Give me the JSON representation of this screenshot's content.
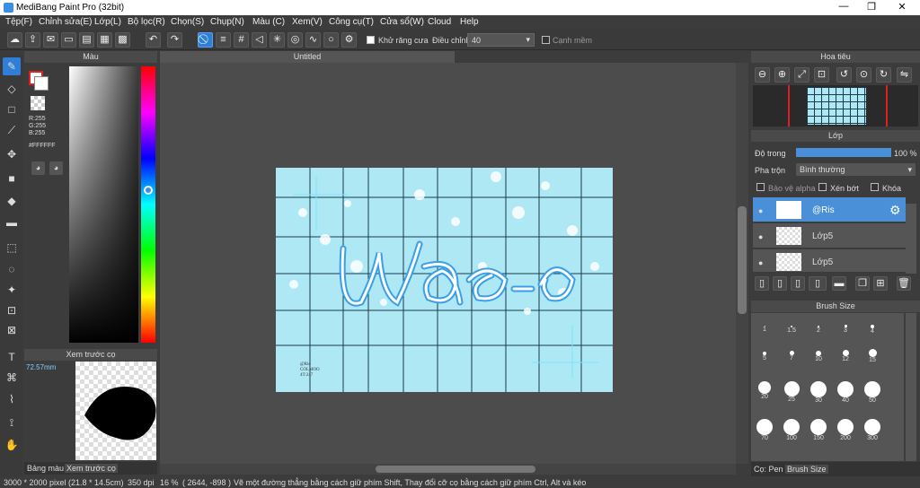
{
  "window": {
    "title": "MediBang Paint Pro (32bit)",
    "min": "—",
    "max": "❐",
    "close": "✕"
  },
  "menu": [
    "Tệp(F)",
    "Chỉnh sửa(E)",
    "Lớp(L)",
    "Bộ lọc(R)",
    "Chọn(S)",
    "Chụp(N)",
    "Màu (C)",
    "Xem(V)",
    "Công cụ(T)",
    "Cửa sổ(W)",
    "Cloud",
    "Help"
  ],
  "toolbar": {
    "antialias_label": "Khử răng cưa",
    "adjust_label": "Điều chỉnh",
    "adjust_value": "40",
    "edge_label": "Cạnh mềm"
  },
  "color_panel": {
    "title": "Màu",
    "r": "R:255",
    "g": "G:255",
    "b": "B:255",
    "hex": "#FFFFFF"
  },
  "preview_panel": {
    "title": "Xem trước cọ",
    "size": "72.57mm"
  },
  "left_tabs": {
    "palette": "Bảng màu",
    "preview": "Xem trước cọ"
  },
  "canvas": {
    "tab": "Untitled",
    "text": "Wao-o",
    "watermark": "@Ris\nCOLMOO\n4T:247"
  },
  "navigator": {
    "title": "Hoa tiêu"
  },
  "layers": {
    "title": "Lớp",
    "opacity_label": "Độ trong",
    "opacity_value": "100 %",
    "blend_label": "Pha trộn",
    "blend_value": "Bình thường",
    "protect_alpha": "Bảo vệ alpha",
    "clip": "Xén bớt",
    "lock": "Khóa",
    "items": [
      {
        "name": "@Ris"
      },
      {
        "name": "Lớp5"
      },
      {
        "name": "Lớp5"
      }
    ]
  },
  "brush_size": {
    "title": "Brush Size",
    "sizes": [
      "1",
      "1.5",
      "2",
      "3",
      "4",
      "5",
      "7",
      "10",
      "12",
      "15",
      "20",
      "25",
      "30",
      "40",
      "50",
      "70",
      "100",
      "150",
      "200",
      "300"
    ],
    "tabs": [
      "Cọ: Pen",
      "Brush Size"
    ]
  },
  "status": {
    "size": "3000 * 2000 pixel",
    "cm": "(21.8 * 14.5cm)",
    "dpi": "350 dpi",
    "zoom": "16 %",
    "coords": "( 2644, -898 )",
    "hint": "Vẽ một đường thẳng bằng cách giữ phím Shift, Thay đổi cỡ cọ bằng cách giữ phím Ctrl, Alt và kéo"
  },
  "colors": {
    "accent": "#2f7fd8",
    "canvas_bg": "#aee8f4",
    "grid": "#1a3a4a"
  }
}
